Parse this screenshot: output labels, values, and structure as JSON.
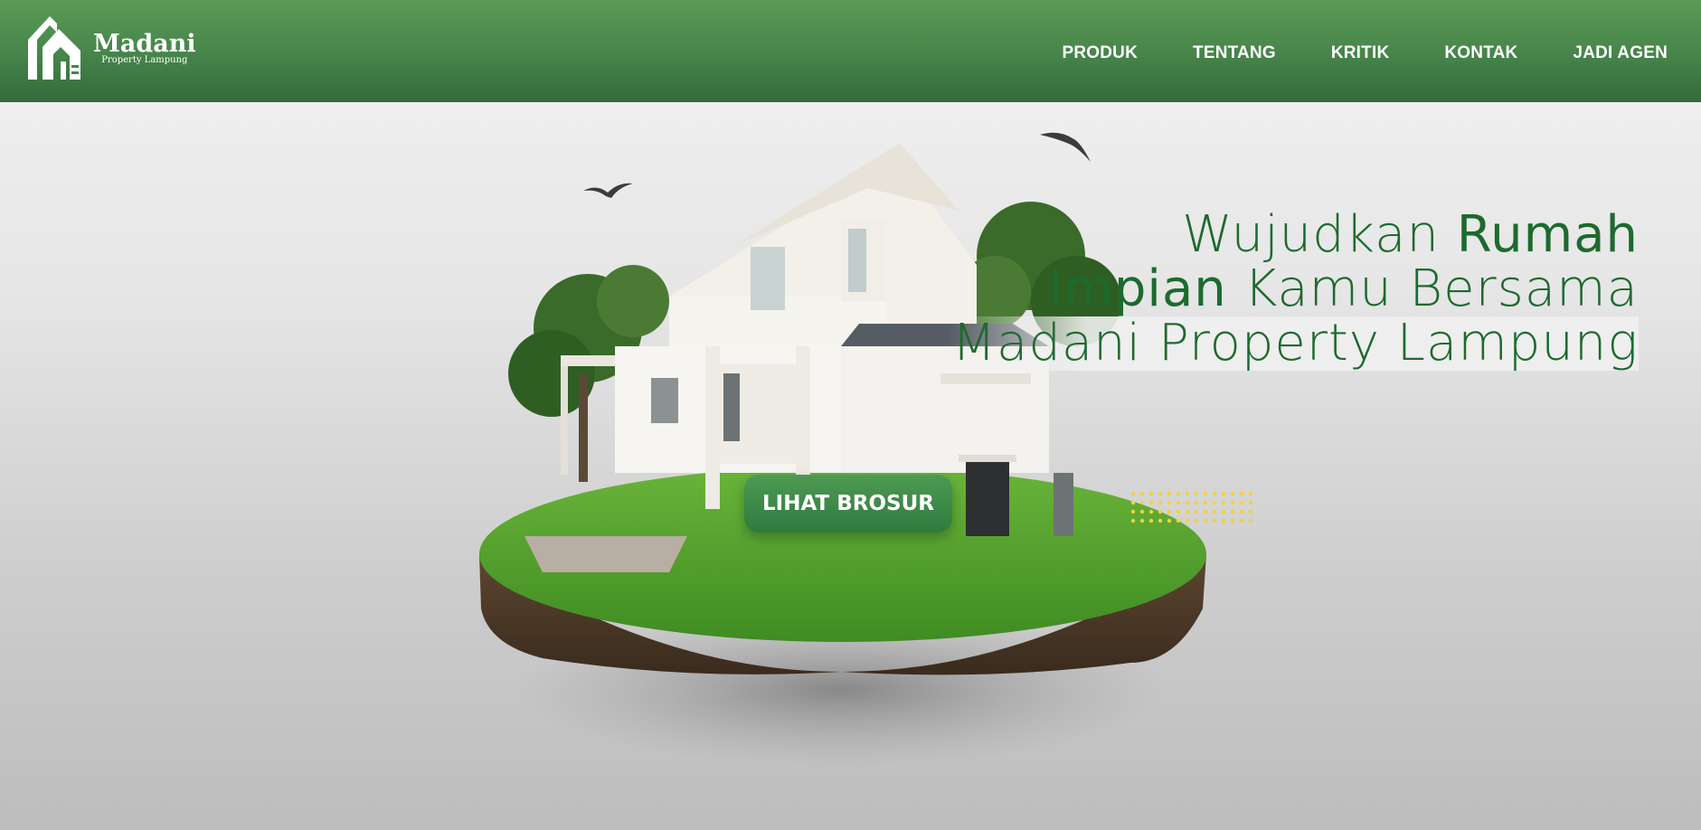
{
  "header": {
    "brand": "Madani",
    "tagline": "Property Lampung",
    "logo_icon": "house-logo-icon"
  },
  "nav": [
    "PRODUK",
    "TENTANG",
    "KRITIK",
    "KONTAK",
    "JADI AGEN"
  ],
  "hero": {
    "line1_light": "Wujudkan ",
    "line1_bold": "Rumah",
    "line2_bold": "Impian",
    "line2_light": " Kamu Bersama",
    "line3": "Madani Property Lampung",
    "cta": "LIHAT BROSUR"
  },
  "colors": {
    "header_green": "#46844a",
    "headline_green": "#1d6a2e",
    "dots_yellow": "#f0d33a"
  }
}
